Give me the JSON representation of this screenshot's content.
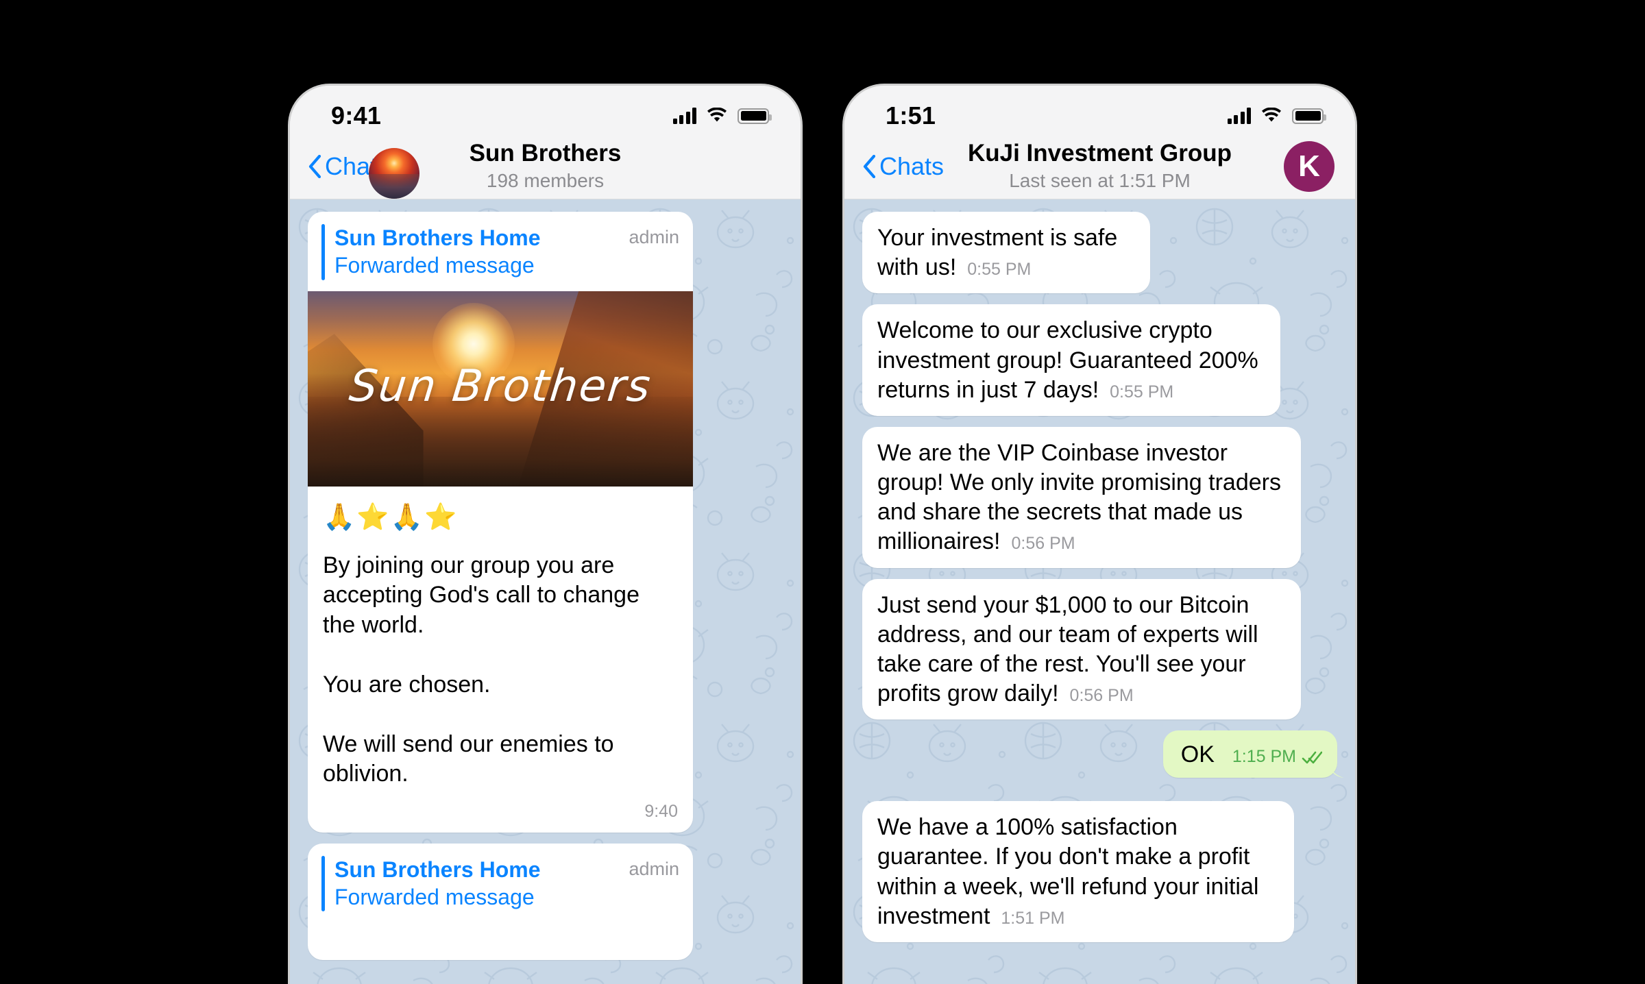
{
  "left_phone": {
    "status": {
      "time": "9:41",
      "signal_icon": "signal-bars-icon",
      "wifi_icon": "wifi-icon",
      "battery_icon": "battery-full-icon"
    },
    "nav": {
      "back_label": "Chats",
      "title": "Sun Brothers",
      "subtitle": "198 members",
      "avatar_type": "sunset-photo"
    },
    "messages": [
      {
        "kind": "forwarded_card",
        "from": "Sun Brothers Home",
        "forward_label": "Forwarded message",
        "role": "admin",
        "photo_caption": "Sun Brothers",
        "emoji": "🙏⭐🙏⭐",
        "body": "By joining our group you are accepting God's call to change the world.\n\nYou are chosen.\n\nWe will send our enemies to oblivion.",
        "time": "9:40"
      },
      {
        "kind": "forwarded_card_partial",
        "from": "Sun Brothers Home",
        "forward_label": "Forwarded message",
        "role": "admin"
      }
    ]
  },
  "right_phone": {
    "status": {
      "time": "1:51",
      "signal_icon": "signal-bars-icon",
      "wifi_icon": "wifi-icon",
      "battery_icon": "battery-full-icon"
    },
    "nav": {
      "back_label": "Chats",
      "title": "KuJi Investment Group",
      "subtitle": "Last seen at 1:51 PM",
      "avatar_letter": "K",
      "avatar_color": "#8b2063"
    },
    "messages": [
      {
        "side": "in",
        "text": "Your investment is safe with us!",
        "time": "0:55 PM"
      },
      {
        "side": "in",
        "text": "Welcome to our exclusive crypto investment group! Guaranteed 200% returns in just 7 days!",
        "time": "0:55 PM"
      },
      {
        "side": "in",
        "text": "We are the VIP Coinbase investor group! We only invite promising traders and share the secrets that made us millionaires!",
        "time": "0:56 PM"
      },
      {
        "side": "in",
        "text": "Just send your $1,000 to our Bitcoin address, and our team of experts will take care of the rest. You'll see your profits grow daily!",
        "time": "0:56 PM"
      },
      {
        "side": "out",
        "text": "OK",
        "time": "1:15 PM",
        "status_icon": "double-check-icon"
      },
      {
        "side": "in",
        "text": "We have a 100% satisfaction guarantee. If you don't make a profit within a week, we'll refund your initial investment",
        "time": "1:51 PM"
      }
    ]
  },
  "theme": {
    "chat_background": "#c8d7e6",
    "incoming_bubble": "#ffffff",
    "outgoing_bubble": "#e3f8c4",
    "accent_blue": "#0a84ff",
    "time_gray": "#9a9a9e",
    "out_time_green": "#4fae4f"
  }
}
